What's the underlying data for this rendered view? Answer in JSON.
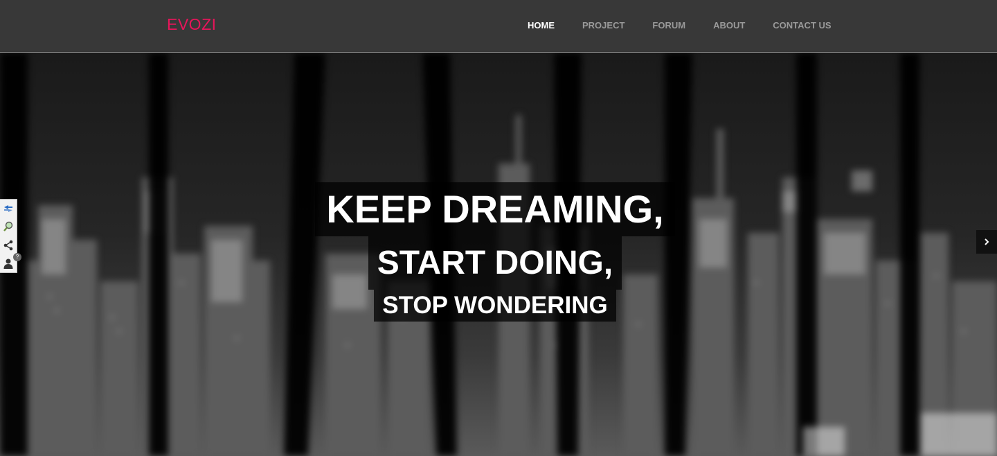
{
  "navbar": {
    "brand": "EVOZI",
    "brand_color": "#e8155b",
    "links": [
      {
        "label": "HOME",
        "active": true
      },
      {
        "label": "PROJECT",
        "active": false
      },
      {
        "label": "FORUM",
        "active": false
      },
      {
        "label": "ABOUT",
        "active": false
      },
      {
        "label": "CONTACT US",
        "active": false
      }
    ]
  },
  "hero": {
    "line1": "KEEP DREAMING,",
    "line2": "START DOING,",
    "line3": "STOP WONDERING",
    "background": "blurred black-and-white city skyline at night"
  },
  "side_toolbar": {
    "icons": [
      "translate-icon",
      "search-icon",
      "share-icon",
      "user-icon"
    ],
    "user_badge": "?"
  },
  "slider": {
    "next_icon": "chevron-right-icon"
  }
}
